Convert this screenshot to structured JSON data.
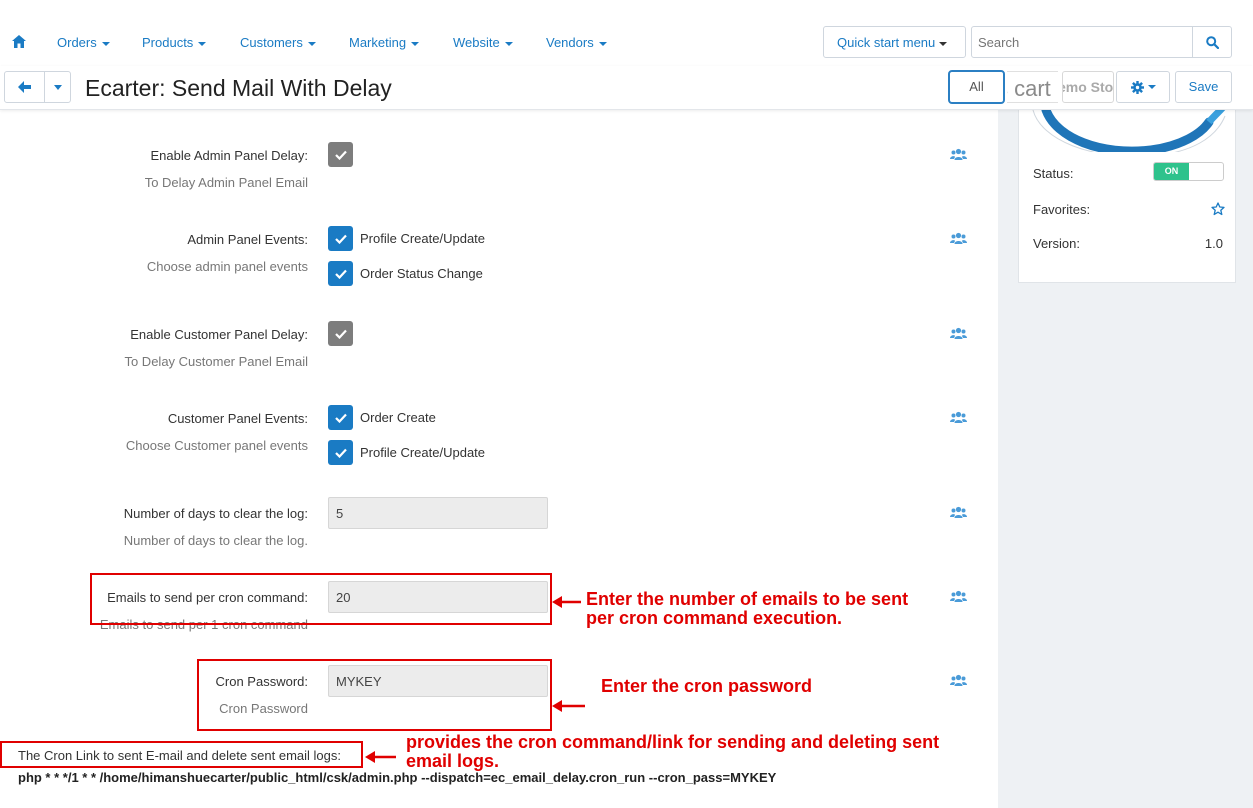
{
  "nav": {
    "items": [
      {
        "label": "Orders"
      },
      {
        "label": "Products"
      },
      {
        "label": "Customers"
      },
      {
        "label": "Marketing"
      },
      {
        "label": "Website"
      },
      {
        "label": "Vendors"
      }
    ],
    "quick_start": "Quick start menu",
    "search_placeholder": "Search"
  },
  "titlebar": {
    "title": "Ecarter: Send Mail With Delay",
    "all_label": "All",
    "store1_text": "s cart",
    "store2_text": "emo Sto",
    "save_label": "Save"
  },
  "sidebar": {
    "status_label": "Status:",
    "status_value": "ON",
    "favorites_label": "Favorites:",
    "version_label": "Version:",
    "version_value": "1.0"
  },
  "form": {
    "admin_delay": {
      "label": "Enable Admin Panel Delay:",
      "desc": "To Delay Admin Panel Email",
      "checked": true
    },
    "admin_events": {
      "label": "Admin Panel Events:",
      "desc": "Choose admin panel events",
      "options": [
        {
          "label": "Profile Create/Update",
          "checked": true
        },
        {
          "label": "Order Status Change",
          "checked": true
        }
      ]
    },
    "customer_delay": {
      "label": "Enable Customer Panel Delay:",
      "desc": "To Delay Customer Panel Email",
      "checked": true
    },
    "customer_events": {
      "label": "Customer Panel Events:",
      "desc": "Choose Customer panel events",
      "options": [
        {
          "label": "Order Create",
          "checked": true
        },
        {
          "label": "Profile Create/Update",
          "checked": true
        }
      ]
    },
    "log_days": {
      "label": "Number of days to clear the log:",
      "desc": "Number of days to clear the log.",
      "value": "5"
    },
    "emails_per_cron": {
      "label": "Emails to send per cron command:",
      "desc": "Emails to send per 1 cron command",
      "value": "20"
    },
    "cron_password": {
      "label": "Cron Password:",
      "desc": "Cron Password",
      "value": "MYKEY"
    },
    "cron_link_label": "The Cron Link to sent E-mail and delete sent email logs:",
    "cron_command": "php * * */1 * * /home/himanshuecarter/public_html/csk/admin.php --dispatch=ec_email_delay.cron_run --cron_pass=MYKEY"
  },
  "annotations": {
    "emails": "Enter the number of emails to be sent per cron command execution.",
    "password": "Enter the cron password",
    "link": "provides the cron command/link for sending and deleting sent email logs."
  },
  "colors": {
    "accent": "#1a7bc4",
    "annotation": "#e00000",
    "toggle_on": "#2ec28c"
  }
}
